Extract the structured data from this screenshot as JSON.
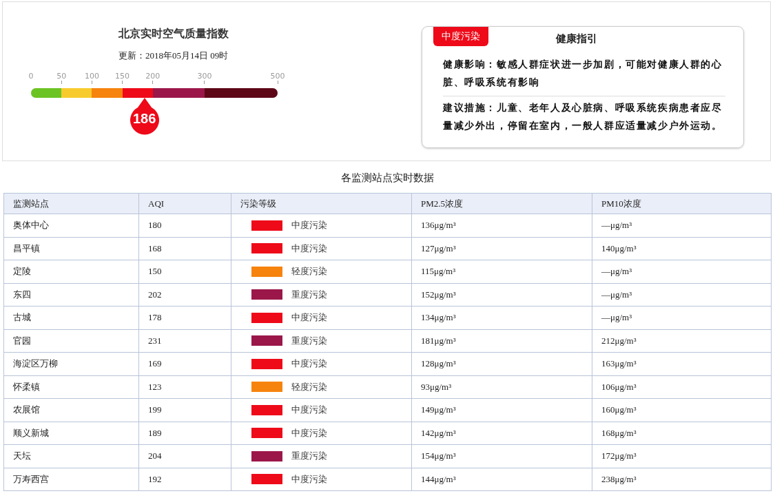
{
  "aqi_panel": {
    "title": "北京实时空气质量指数",
    "updated": "更新：2018年05月14日 09时",
    "scale": {
      "ticks": [
        "0",
        "50",
        "100",
        "150",
        "200",
        "300",
        "500"
      ],
      "segments": [
        {
          "color": "#6cc424"
        },
        {
          "color": "#f8cb2c"
        },
        {
          "color": "#f6830e"
        },
        {
          "color": "#ee0a19"
        },
        {
          "color": "#9b1749"
        },
        {
          "color": "#5e0717"
        }
      ],
      "pointer": {
        "value": "186",
        "level": 0.46,
        "color": "#ee0a19"
      }
    }
  },
  "health_card": {
    "badge": {
      "label": "中度污染",
      "color": "#ee0a19"
    },
    "title": "健康指引",
    "effect": "健康影响：敏感人群症状进一步加剧，可能对健康人群的心脏、呼吸系统有影响",
    "advice": "建议措施：儿童、老年人及心脏病、呼吸系统疾病患者应尽量减少外出，停留在室内，一般人群应适量减少户外运动。"
  },
  "table": {
    "title": "各监测站点实时数据",
    "columns": [
      "监测站点",
      "AQI",
      "污染等级",
      "PM2.5浓度",
      "PM10浓度"
    ],
    "rows": [
      {
        "station": "奥体中心",
        "aqi": "180",
        "level": "中度污染",
        "color": "#ee0a19",
        "pm25": "136μg/m³",
        "pm10": "—μg/m³"
      },
      {
        "station": "昌平镇",
        "aqi": "168",
        "level": "中度污染",
        "color": "#ee0a19",
        "pm25": "127μg/m³",
        "pm10": "140μg/m³"
      },
      {
        "station": "定陵",
        "aqi": "150",
        "level": "轻度污染",
        "color": "#f6830e",
        "pm25": "115μg/m³",
        "pm10": "—μg/m³"
      },
      {
        "station": "东四",
        "aqi": "202",
        "level": "重度污染",
        "color": "#9b1749",
        "pm25": "152μg/m³",
        "pm10": "—μg/m³"
      },
      {
        "station": "古城",
        "aqi": "178",
        "level": "中度污染",
        "color": "#ee0a19",
        "pm25": "134μg/m³",
        "pm10": "—μg/m³"
      },
      {
        "station": "官园",
        "aqi": "231",
        "level": "重度污染",
        "color": "#9b1749",
        "pm25": "181μg/m³",
        "pm10": "212μg/m³"
      },
      {
        "station": "海淀区万柳",
        "aqi": "169",
        "level": "中度污染",
        "color": "#ee0a19",
        "pm25": "128μg/m³",
        "pm10": "163μg/m³"
      },
      {
        "station": "怀柔镇",
        "aqi": "123",
        "level": "轻度污染",
        "color": "#f6830e",
        "pm25": "93μg/m³",
        "pm10": "106μg/m³"
      },
      {
        "station": "农展馆",
        "aqi": "199",
        "level": "中度污染",
        "color": "#ee0a19",
        "pm25": "149μg/m³",
        "pm10": "160μg/m³"
      },
      {
        "station": "顺义新城",
        "aqi": "189",
        "level": "中度污染",
        "color": "#ee0a19",
        "pm25": "142μg/m³",
        "pm10": "168μg/m³"
      },
      {
        "station": "天坛",
        "aqi": "204",
        "level": "重度污染",
        "color": "#9b1749",
        "pm25": "154μg/m³",
        "pm10": "172μg/m³"
      },
      {
        "station": "万寿西宫",
        "aqi": "192",
        "level": "中度污染",
        "color": "#ee0a19",
        "pm25": "144μg/m³",
        "pm10": "238μg/m³"
      }
    ]
  }
}
